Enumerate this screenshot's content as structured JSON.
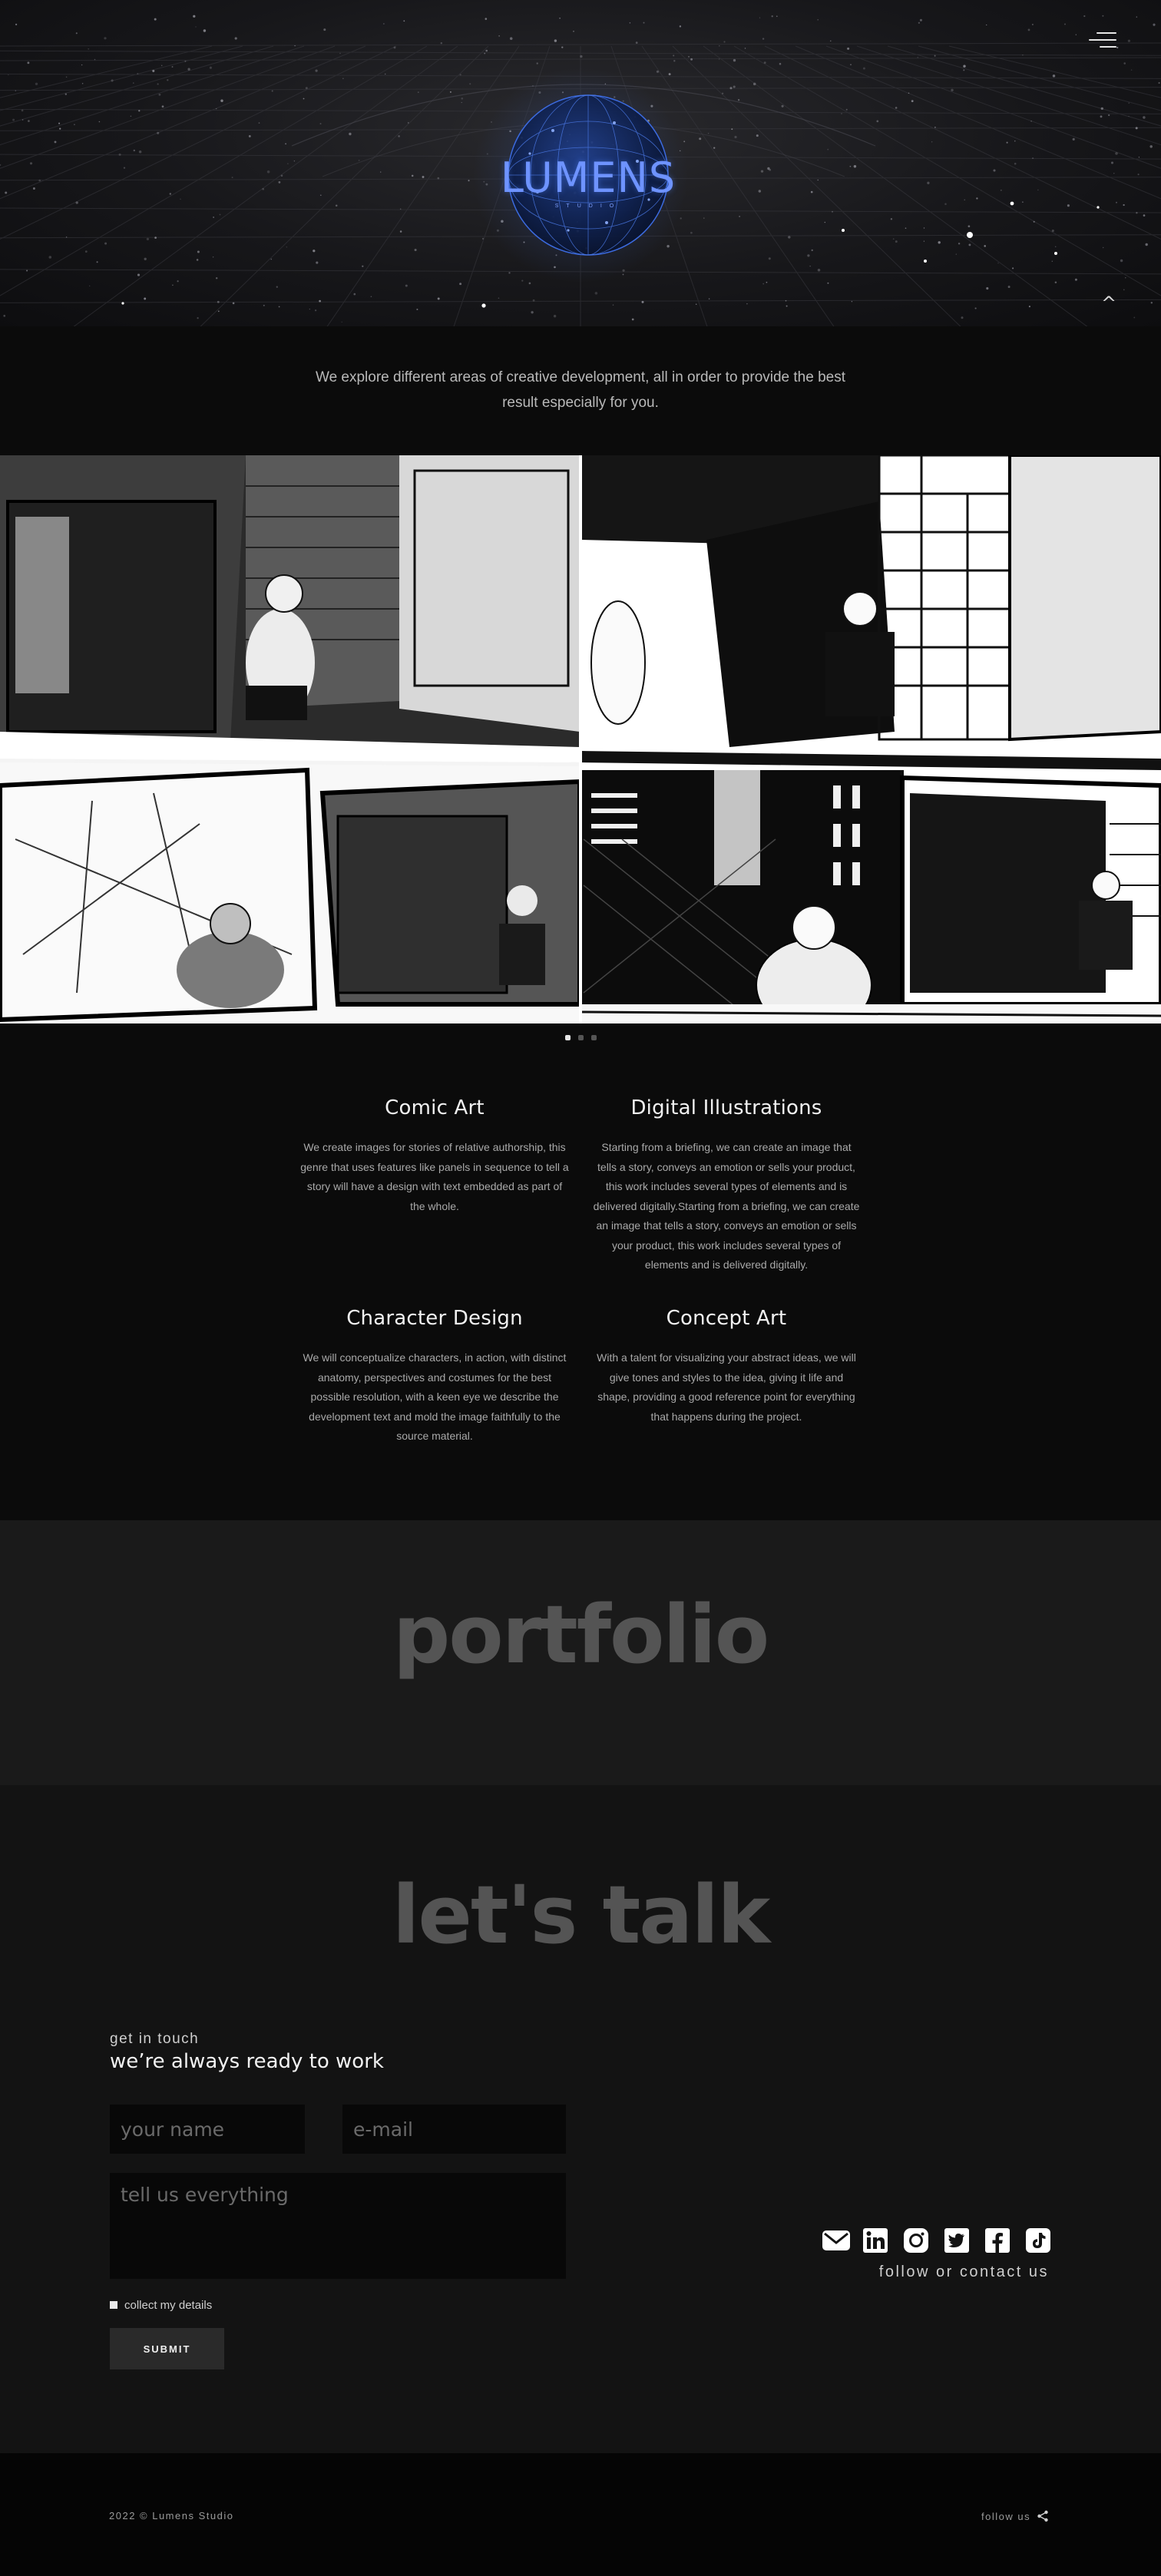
{
  "brand": {
    "name": "LUMENS",
    "tagline": "STUDIO",
    "accent": "#6e93ff"
  },
  "intro": {
    "text": "We explore different areas of creative development, all in order to provide the best result especially for you."
  },
  "carousel": {
    "slides": 3,
    "active_index": 0
  },
  "services": [
    {
      "title": "Comic Art",
      "text": "We create images for stories of relative authorship, this genre that uses features like panels in sequence to tell a story will have a design with text embedded as part of the whole."
    },
    {
      "title": "Digital Illustrations",
      "text": "Starting from a briefing, we can create an image that tells a story, conveys an emotion or sells your product, this work includes several types of elements and is delivered digitally.Starting from a briefing, we can create an image that tells a story, conveys an emotion or sells your product, this work includes several types of elements and is delivered digitally."
    },
    {
      "title": "Character Design",
      "text": "We will conceptualize characters, in action, with distinct anatomy, perspectives and costumes for the best possible resolution, with a keen eye we describe the development text and mold the image faithfully to the source material."
    },
    {
      "title": "Concept Art",
      "text": "With a talent for visualizing your abstract ideas, we will give tones and styles to the idea, giving it life and shape, providing a good reference point for everything that happens during the project."
    }
  ],
  "portfolio": {
    "title": "portfolio"
  },
  "contact": {
    "title": "let's talk",
    "kicker": "get in touch",
    "headline": "we’re always ready to work",
    "name_placeholder": "your name",
    "email_placeholder": "e-mail",
    "message_placeholder": "tell us everything",
    "consent_label": "collect my details",
    "submit_label": "SUBMIT",
    "socials": [
      "mail-icon",
      "linkedin-icon",
      "instagram-icon",
      "twitter-icon",
      "facebook-icon",
      "tiktok-icon"
    ],
    "follow_text": "follow or contact us"
  },
  "footer": {
    "copyright": "2022 © Lumens Studio",
    "follow_label": "follow us",
    "share_icon": "share-icon"
  }
}
